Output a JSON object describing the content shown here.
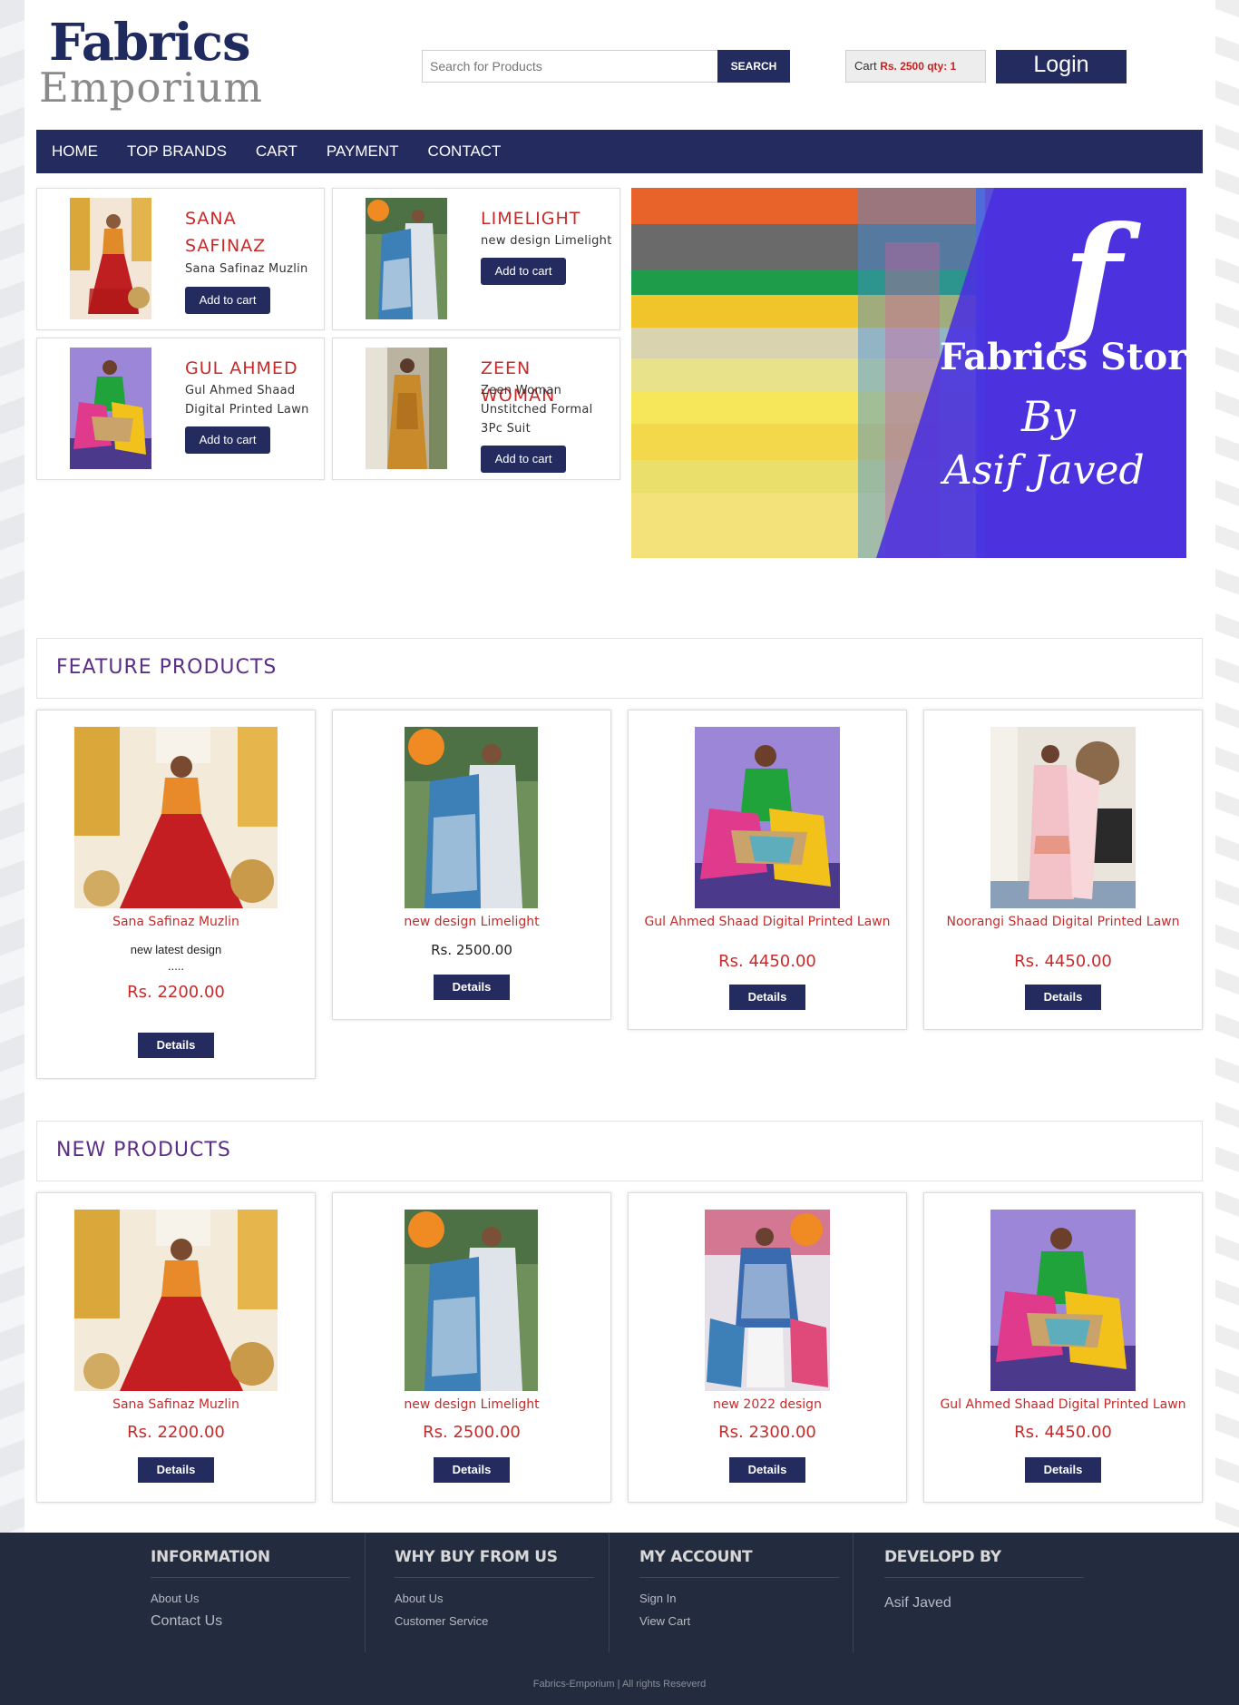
{
  "logo": {
    "line1": "Fabrics",
    "line2": "Emporium"
  },
  "search": {
    "placeholder": "Search for Products",
    "button": "SEARCH"
  },
  "cart": {
    "label": "Cart",
    "summary": "Rs. 2500 qty: 1"
  },
  "login": {
    "label": "Login"
  },
  "nav": [
    "HOME",
    "TOP BRANDS",
    "CART",
    "PAYMENT",
    "CONTACT"
  ],
  "top_products": [
    {
      "title": "SANA SAFINAZ",
      "desc": "Sana Safinaz Muzlin",
      "button": "Add to cart"
    },
    {
      "title": "LIMELIGHT",
      "desc": "new design Limelight",
      "button": "Add to cart"
    },
    {
      "title": "GUL AHMED",
      "desc": "Gul Ahmed Shaad Digital Printed Lawn",
      "button": "Add to cart"
    },
    {
      "title": "ZEEN WOMAN",
      "desc": "Zeen Woman Unstitched Formal 3Pc Suit",
      "button": "Add to cart"
    }
  ],
  "banner": {
    "logo_letter": "f",
    "line1": "Fabrics Store",
    "line2": "By",
    "line3": "Asif Javed"
  },
  "feature": {
    "heading": "FEATURE PRODUCTS",
    "items": [
      {
        "name": "Sana Safinaz Muzlin",
        "desc": "new latest design",
        "dots": ".....",
        "price": "Rs. 2200.00",
        "button": "Details"
      },
      {
        "name": "new design Limelight",
        "price": "Rs. 2500.00",
        "button": "Details"
      },
      {
        "name": "Gul Ahmed Shaad Digital Printed Lawn",
        "price": "Rs. 4450.00",
        "button": "Details"
      },
      {
        "name": "Noorangi Shaad Digital Printed Lawn",
        "price": "Rs. 4450.00",
        "button": "Details"
      }
    ]
  },
  "new_products": {
    "heading": "NEW PRODUCTS",
    "items": [
      {
        "name": "Sana Safinaz Muzlin",
        "price": "Rs. 2200.00",
        "button": "Details"
      },
      {
        "name": "new design Limelight",
        "price": "Rs. 2500.00",
        "button": "Details"
      },
      {
        "name": "new 2022 design",
        "price": "Rs. 2300.00",
        "button": "Details"
      },
      {
        "name": "Gul Ahmed Shaad Digital Printed Lawn",
        "price": "Rs. 4450.00",
        "button": "Details"
      }
    ]
  },
  "footer": {
    "information": {
      "heading": "INFORMATION",
      "links": [
        "About Us",
        "Contact Us"
      ]
    },
    "why": {
      "heading": "WHY BUY FROM US",
      "links": [
        "About Us",
        "Customer Service"
      ]
    },
    "account": {
      "heading": "MY ACCOUNT",
      "links": [
        "Sign In",
        "View Cart"
      ]
    },
    "developer": {
      "heading": "DEVELOPD BY",
      "name": "Asif Javed"
    },
    "copyright": "Fabrics-Emporium | All rights Reseverd"
  },
  "colors": {
    "brand_navy": "#232b5f",
    "price_red": "#c62b2b",
    "section_purple": "#5b2f86",
    "footer_bg": "#232b3e"
  }
}
